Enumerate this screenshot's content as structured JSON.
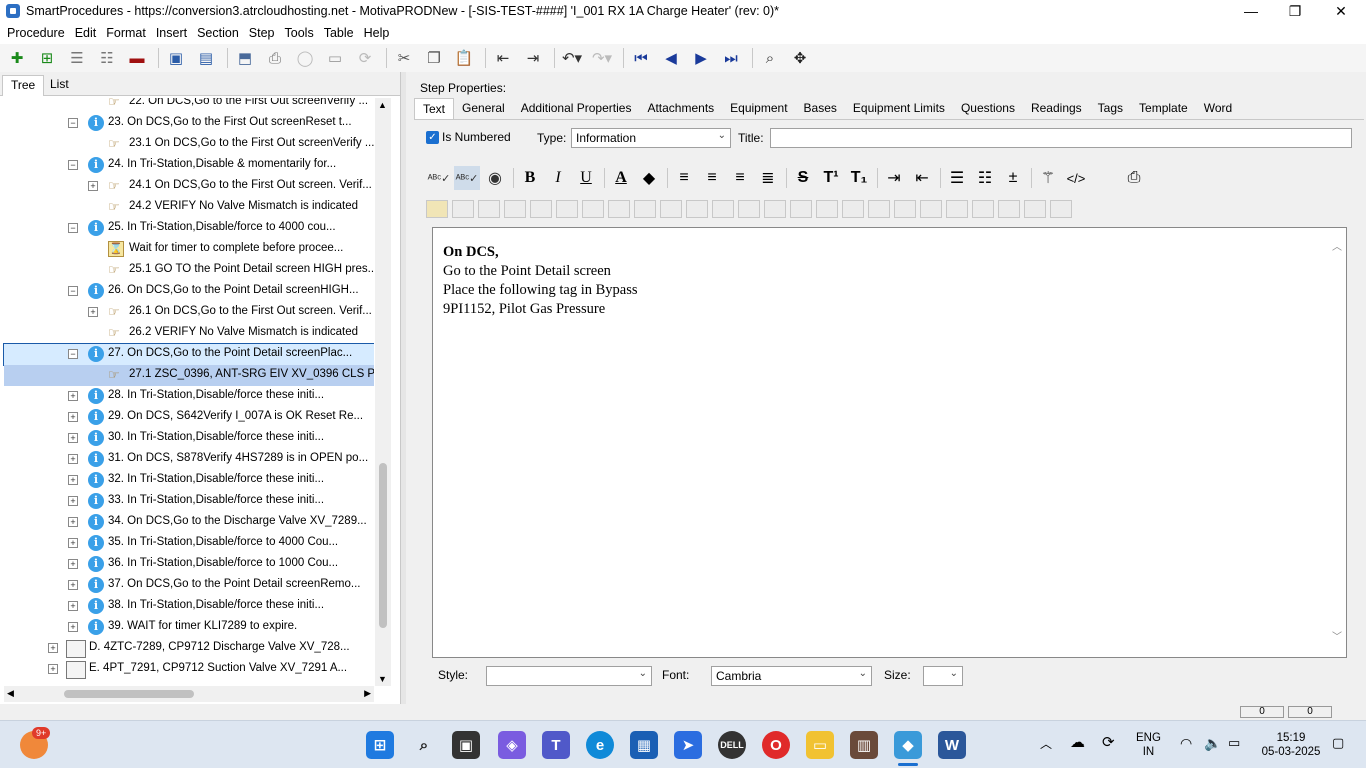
{
  "window": {
    "title": "SmartProcedures - https://conversion3.atrcloudhosting.net - MotivaPRODNew - [-SIS-TEST-####] 'I_001 RX 1A Charge Heater' (rev: 0)*",
    "minimize": "—",
    "maximize": "❐",
    "close": "✕"
  },
  "menu": [
    "Procedure",
    "Edit",
    "Format",
    "Insert",
    "Section",
    "Step",
    "Tools",
    "Table",
    "Help"
  ],
  "left_tabs": {
    "tree": "Tree",
    "list": "List"
  },
  "tree": [
    {
      "label": "22. On DCS,Go to the First Out screenVerify ...",
      "indent": 1,
      "icon": "hand",
      "expander": ""
    },
    {
      "label": "23. On DCS,Go to the First Out screenReset t...",
      "indent": 0,
      "icon": "info",
      "expander": "−"
    },
    {
      "label": "23.1 On DCS,Go to the First Out screenVerify ...",
      "indent": 1,
      "icon": "hand",
      "expander": ""
    },
    {
      "label": "24. In Tri-Station,Disable & momentarily for...",
      "indent": 0,
      "icon": "info",
      "expander": "−"
    },
    {
      "label": "24.1 On DCS,Go to the First Out screen. Verif...",
      "indent": 1,
      "icon": "hand",
      "expander": "+"
    },
    {
      "label": "24.2 VERIFY No Valve Mismatch is indicated",
      "indent": 1,
      "icon": "hand",
      "expander": ""
    },
    {
      "label": "25. In Tri-Station,Disable/force to 4000 cou...",
      "indent": 0,
      "icon": "info",
      "expander": "−"
    },
    {
      "label": "Wait for timer to complete before procee...",
      "indent": 1,
      "icon": "timer",
      "expander": ""
    },
    {
      "label": "25.1 GO TO the Point Detail screen HIGH pres...",
      "indent": 1,
      "icon": "hand",
      "expander": ""
    },
    {
      "label": "26. On DCS,Go to the Point Detail screenHIGH...",
      "indent": 0,
      "icon": "info",
      "expander": "−"
    },
    {
      "label": "26.1 On DCS,Go to the First Out screen. Verif...",
      "indent": 1,
      "icon": "hand",
      "expander": "+"
    },
    {
      "label": "26.2 VERIFY No Valve Mismatch is indicated",
      "indent": 1,
      "icon": "hand",
      "expander": ""
    },
    {
      "label": "27. On DCS,Go to the Point Detail screenPlac...",
      "indent": 0,
      "icon": "info",
      "expander": "−",
      "state": "selected"
    },
    {
      "label": "27.1 ZSC_0396, ANT-SRG EIV XV_0396 CLS P...",
      "indent": 1,
      "icon": "hand",
      "expander": "",
      "state": "highlighted"
    },
    {
      "label": "28. In Tri-Station,Disable/force these initi...",
      "indent": 0,
      "icon": "info",
      "expander": "+"
    },
    {
      "label": "29. On DCS, S642Verify I_007A is OK Reset Re...",
      "indent": 0,
      "icon": "info",
      "expander": "+"
    },
    {
      "label": "30. In Tri-Station,Disable/force these initi...",
      "indent": 0,
      "icon": "info",
      "expander": "+"
    },
    {
      "label": "31. On DCS, S878Verify 4HS7289 is in OPEN po...",
      "indent": 0,
      "icon": "info",
      "expander": "+"
    },
    {
      "label": "32. In Tri-Station,Disable/force these initi...",
      "indent": 0,
      "icon": "info",
      "expander": "+"
    },
    {
      "label": "33. In Tri-Station,Disable/force these initi...",
      "indent": 0,
      "icon": "info",
      "expander": "+"
    },
    {
      "label": "34. On DCS,Go to the Discharge Valve XV_7289...",
      "indent": 0,
      "icon": "info",
      "expander": "+"
    },
    {
      "label": "35. In Tri-Station,Disable/force to 4000 Cou...",
      "indent": 0,
      "icon": "info",
      "expander": "+"
    },
    {
      "label": "36. In Tri-Station,Disable/force to 1000 Cou...",
      "indent": 0,
      "icon": "info",
      "expander": "+"
    },
    {
      "label": "37. On DCS,Go to the Point Detail screenRemo...",
      "indent": 0,
      "icon": "info",
      "expander": "+"
    },
    {
      "label": "38. In Tri-Station,Disable/force these initi...",
      "indent": 0,
      "icon": "info",
      "expander": "+"
    },
    {
      "label": "39. WAIT for timer KLI7289 to expire.",
      "indent": 0,
      "icon": "info",
      "expander": "+"
    },
    {
      "label": "D. 4ZTC-7289, CP9712 Discharge Valve XV_728...",
      "indent": -1,
      "icon": "doc",
      "expander": "+"
    },
    {
      "label": "E. 4PT_7291, CP9712 Suction Valve XV_7291 A...",
      "indent": -1,
      "icon": "doc",
      "expander": "+"
    }
  ],
  "step_properties": {
    "label": "Step Properties:",
    "tabs": [
      "Text",
      "General",
      "Additional Properties",
      "Attachments",
      "Equipment",
      "Bases",
      "Equipment Limits",
      "Questions",
      "Readings",
      "Tags",
      "Template",
      "Word"
    ],
    "is_numbered_label": "Is Numbered",
    "is_numbered": true,
    "type_label": "Type:",
    "type_value": "Information",
    "title_label": "Title:",
    "title_value": ""
  },
  "editor": {
    "lines": [
      "On DCS,",
      "Go to the Point Detail screen",
      "Place the following tag in Bypass",
      "9PI1152, Pilot Gas Pressure"
    ]
  },
  "bottom": {
    "style_label": "Style:",
    "style_value": "",
    "font_label": "Font:",
    "font_value": "Cambria",
    "size_label": "Size:",
    "size_value": ""
  },
  "status": {
    "val1": "0",
    "val2": "0"
  },
  "taskbar": {
    "badge": "9+",
    "lang": "ENG",
    "region": "IN",
    "time": "15:19",
    "date": "05-03-2025"
  },
  "colors": {
    "accent": "#1a6fd0",
    "selection": "#1a5aa8",
    "taskbar": "#dde6f1"
  }
}
